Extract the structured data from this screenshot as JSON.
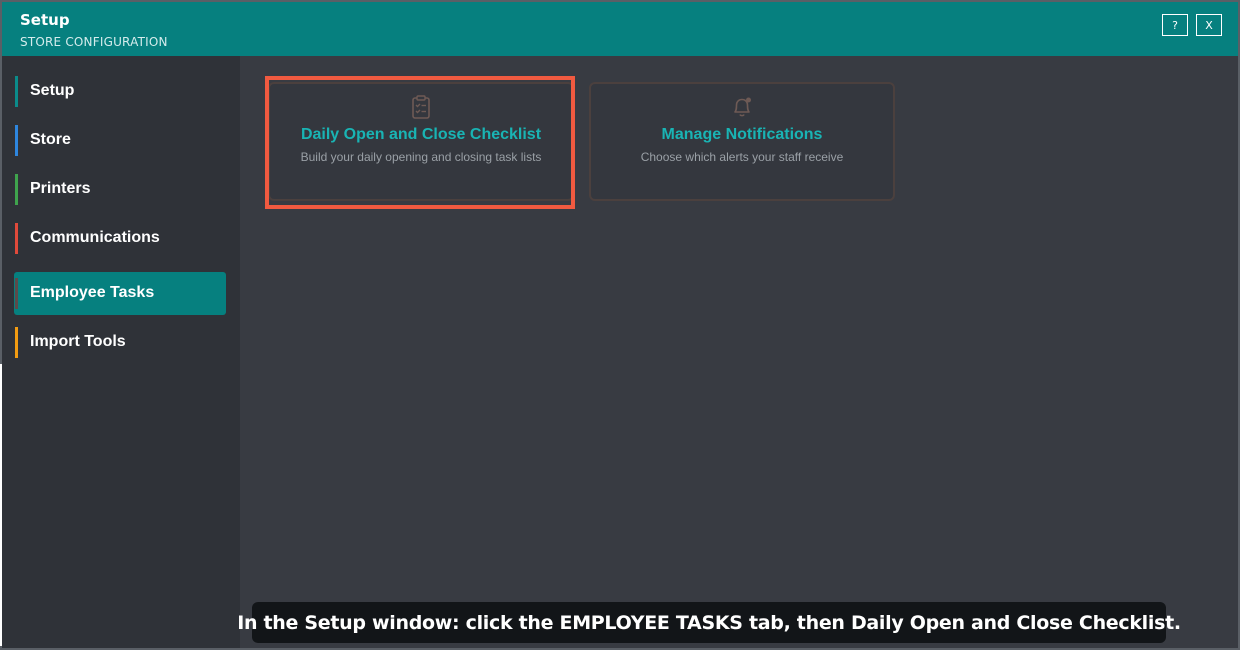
{
  "window": {
    "title": "Setup",
    "subtitle": "STORE CONFIGURATION",
    "help_label": "?",
    "close_label": "X"
  },
  "sidebar": {
    "items": [
      {
        "label": "Setup",
        "accent": "#0b8b8a",
        "active": false
      },
      {
        "label": "Store",
        "accent": "#2e86de",
        "active": false
      },
      {
        "label": "Printers",
        "accent": "#3fa34d",
        "active": false
      },
      {
        "label": "Communications",
        "accent": "#e04a3b",
        "active": false
      },
      {
        "label": "Employee Tasks",
        "accent": "#5b4b4b",
        "active": true
      },
      {
        "label": "Import Tools",
        "accent": "#f39c12",
        "active": false
      }
    ]
  },
  "cards": [
    {
      "icon": "clipboard-checklist-icon",
      "title": "Daily Open and Close Checklist",
      "description": "Build your daily opening and closing task lists",
      "highlighted": true
    },
    {
      "icon": "bell-icon",
      "title": "Manage Notifications",
      "description": "Choose which alerts your staff receive",
      "highlighted": false
    }
  ],
  "instruction": "In the Setup window: click the EMPLOYEE TASKS tab, then Daily Open and Close Checklist.",
  "colors": {
    "titlebar": "#06807f",
    "active_nav": "#06807f",
    "card_title": "#19b4b4",
    "highlight": "#f15a40"
  }
}
